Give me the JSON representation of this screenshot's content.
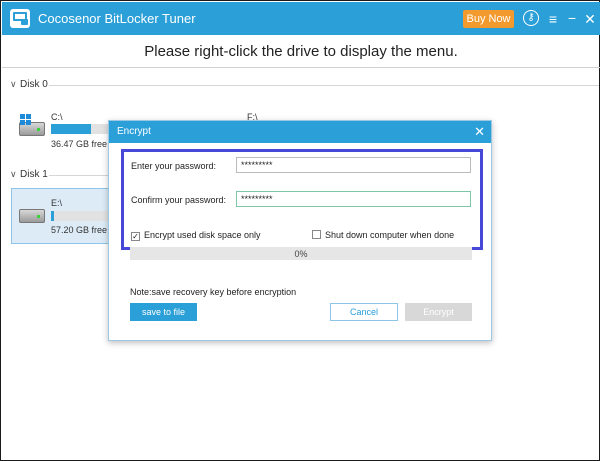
{
  "app": {
    "title": "Cocosenor BitLocker Tuner",
    "buy_label": "Buy Now",
    "icons": [
      "key-icon",
      "menu-icon",
      "minimize-icon",
      "close-icon"
    ],
    "menu_glyph": "≡",
    "min_glyph": "−",
    "close_glyph": "✕",
    "key_glyph": "⚷"
  },
  "header": {
    "message": "Please right-click the drive to display the menu."
  },
  "disks": [
    {
      "label": "Disk 0",
      "drives": [
        {
          "name": "C:\\",
          "free": "36.47 GB free of",
          "used_fraction": 0.7,
          "os": true
        },
        {
          "name": "F:\\"
        }
      ]
    },
    {
      "label": "Disk 1",
      "drives": [
        {
          "name": "E:\\",
          "free": "57.20 GB free of",
          "used_fraction": 0.05,
          "selected": true
        }
      ]
    }
  ],
  "dialog": {
    "title": "Encrypt",
    "close_glyph": "✕",
    "password_label": "Enter your password:",
    "password_value": "*********",
    "confirm_label": "Confirm your password:",
    "confirm_value": "*********",
    "checkbox_used_space": {
      "label": "Encrypt used disk space only",
      "checked": true,
      "mark": "✓"
    },
    "checkbox_shutdown": {
      "label": "Shut down computer when done",
      "checked": false,
      "mark": ""
    },
    "progress_text": "0%",
    "progress_value": 0,
    "note": "Note:save recovery key before encryption",
    "save_label": "save to file",
    "cancel_label": "Cancel",
    "encrypt_label": "Encrypt"
  },
  "colors": {
    "accent": "#2a9fd8",
    "buy": "#f29a2e",
    "highlight_border": "#4848d8",
    "disabled": "#d8d8d8"
  }
}
